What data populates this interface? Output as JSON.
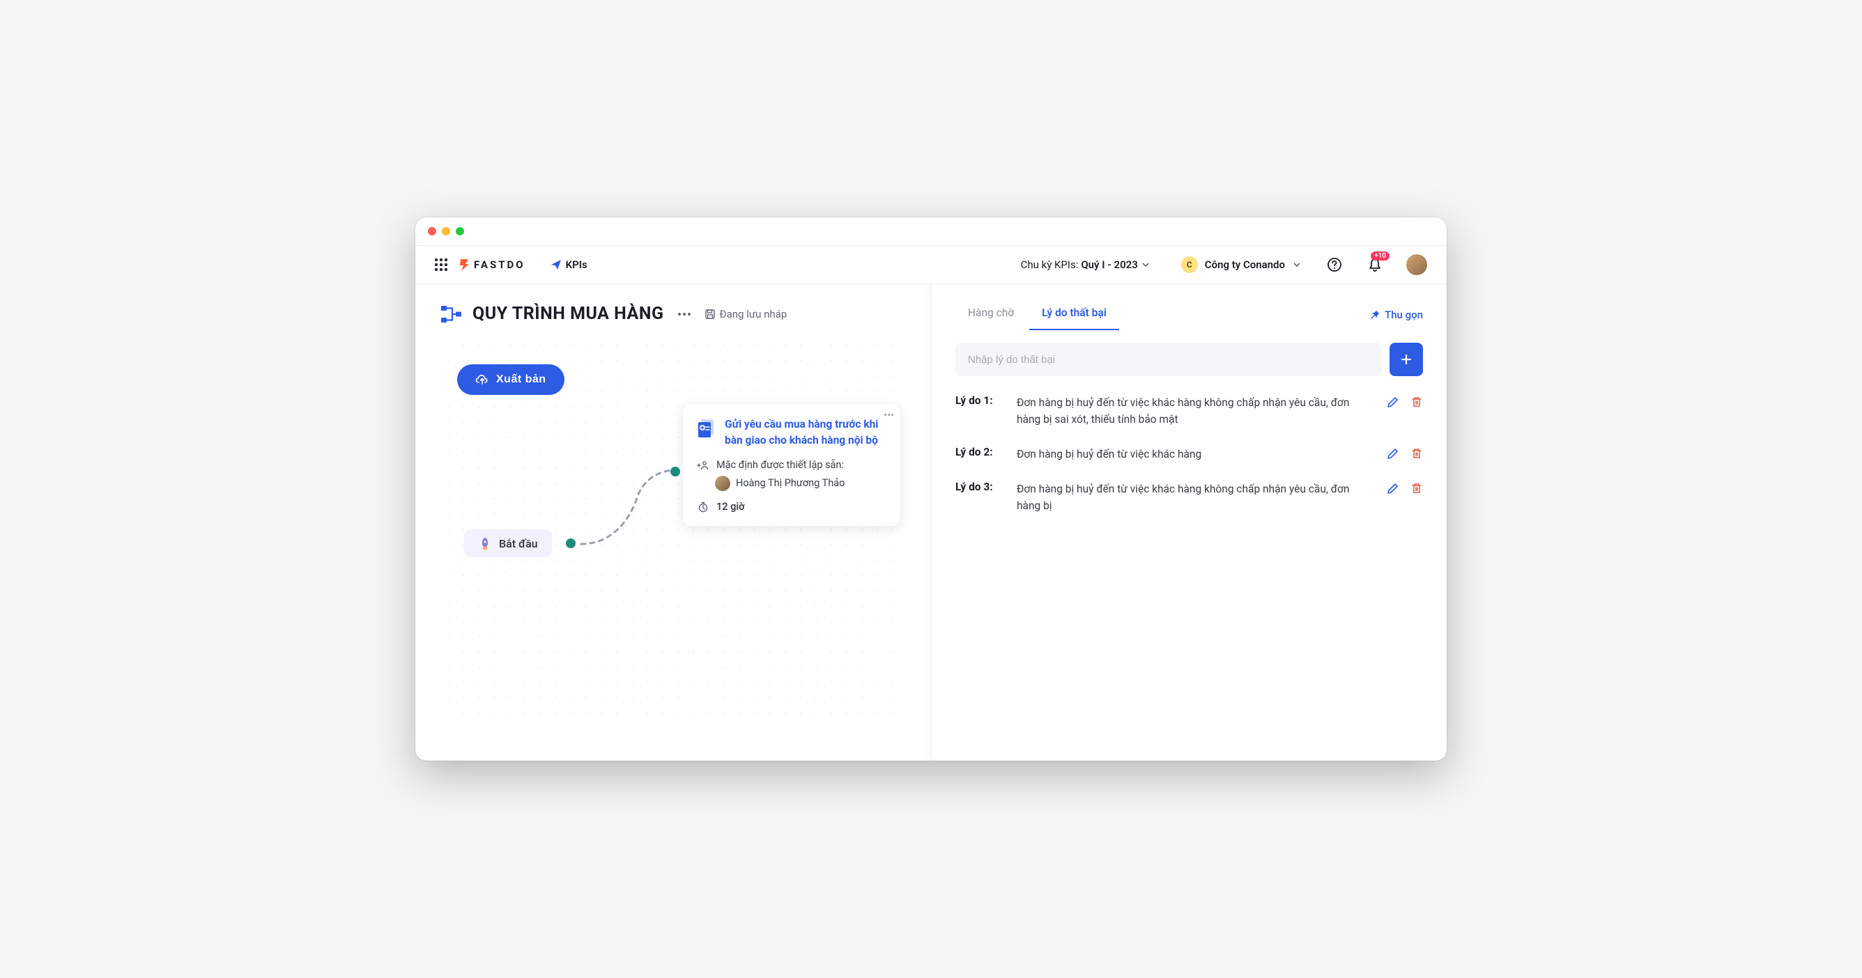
{
  "header": {
    "brand": "FASTDO",
    "app": "KPIs",
    "cycle_label": "Chu kỳ KPIs:",
    "cycle_value": "Quý I - 2023",
    "org_badge": "C",
    "org_name": "Công ty Conando",
    "notif_count": "+10"
  },
  "page": {
    "title": "QUY TRÌNH MUA HÀNG",
    "draft_status": "Đang lưu nháp",
    "publish_label": "Xuất bản",
    "start_label": "Bắt đầu"
  },
  "step": {
    "title": "Gửi yêu cầu mua hàng trước khi bàn giao cho khách hàng nội bộ",
    "default_label": "Mặc định được thiết lập sẵn:",
    "assignee": "Hoàng Thị Phương Thảo",
    "duration": "12 giờ"
  },
  "right": {
    "tab_queue": "Hàng chờ",
    "tab_fail": "Lý do thất bại",
    "collapse": "Thu gọn",
    "input_placeholder": "Nhập lý do thất bại",
    "reasons": [
      {
        "label": "Lý do 1:",
        "text": "Đơn hàng bị huỷ đến từ việc khác hàng không chấp nhận yêu cầu, đơn hàng bị sai xót, thiếu tính bảo mật"
      },
      {
        "label": "Lý do 2:",
        "text": "Đơn hàng bị huỷ đến từ việc khác hàng"
      },
      {
        "label": "Lý do 3:",
        "text": "Đơn hàng bị huỷ đến từ việc khác hàng không chấp nhận yêu cầu, đơn hàng bị"
      }
    ]
  }
}
